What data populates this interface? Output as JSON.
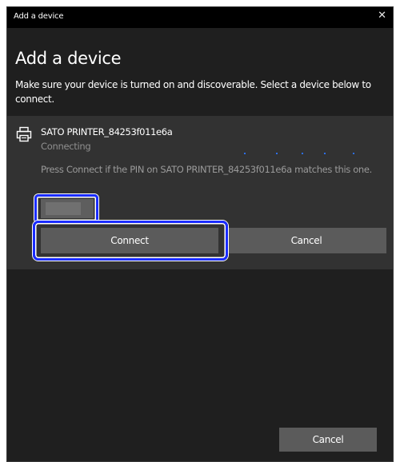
{
  "window": {
    "title": "Add a device",
    "close_glyph": "✕"
  },
  "heading": "Add a device",
  "instructions": "Make sure your device is turned on and discoverable. Select a device below to connect.",
  "device": {
    "icon": "printer-icon",
    "name": "SATO PRINTER_84253f011e6a",
    "status": "Connecting",
    "pin_message": "Press Connect if the PIN on SATO PRINTER_84253f011e6a matches this one.",
    "pin_value": ""
  },
  "buttons": {
    "connect": "Connect",
    "cancel_inline": "Cancel",
    "cancel_bottom": "Cancel"
  },
  "colors": {
    "dialog_bg": "#1f1f1f",
    "card_bg": "#323232",
    "button_bg": "#5b5b5b",
    "highlight": "#1a2cff",
    "progress_dots": "#2d6fe8"
  }
}
